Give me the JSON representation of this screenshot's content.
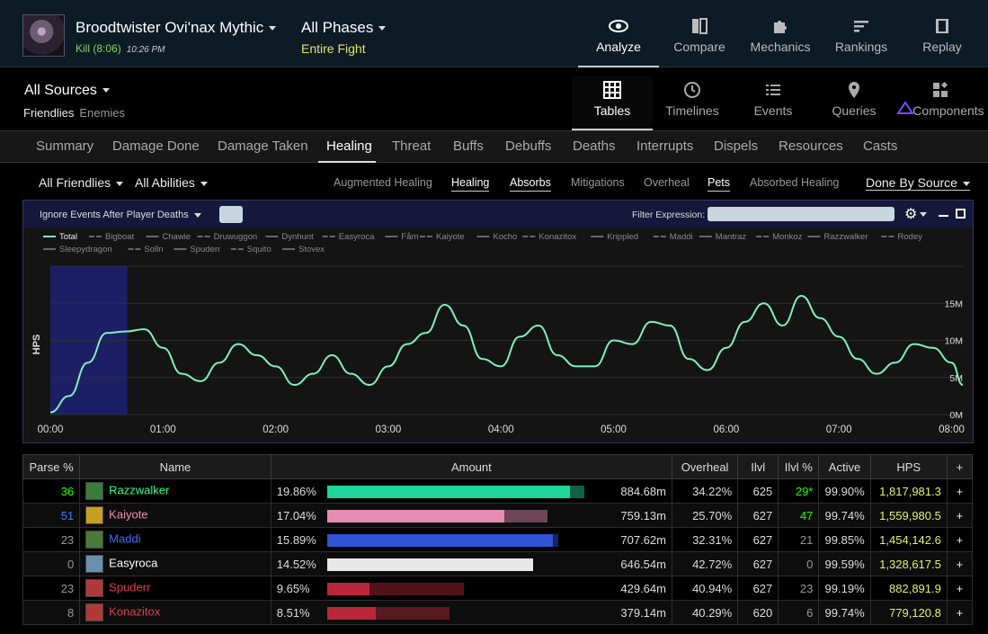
{
  "header": {
    "boss": "Broodtwister Ovi'nax Mythic",
    "kill": "Kill (8:06)",
    "time": "10:26 PM",
    "phase": "All Phases",
    "phase_sub": "Entire Fight",
    "nav": [
      "Analyze",
      "Compare",
      "Mechanics",
      "Rankings",
      "Replay"
    ]
  },
  "subheader": {
    "sources": "All Sources",
    "friendlies": "Friendlies",
    "enemies": "Enemies",
    "views": [
      "Tables",
      "Timelines",
      "Events",
      "Queries",
      "Components"
    ]
  },
  "tabs": [
    "Summary",
    "Damage Done",
    "Damage Taken",
    "Healing",
    "Threat",
    "Buffs",
    "Debuffs",
    "Deaths",
    "Interrupts",
    "Dispels",
    "Resources",
    "Casts"
  ],
  "filters": {
    "friendlies": "All Friendlies",
    "abilities": "All Abilities",
    "subviews": [
      "Augmented Healing",
      "Healing",
      "Absorbs",
      "Mitigations",
      "Overheal",
      "Pets",
      "Absorbed Healing"
    ],
    "done_by": "Done By Source"
  },
  "graph": {
    "ignore": "Ignore Events After Player Deaths",
    "filter_label": "Filter Expression:",
    "legend": [
      "Total",
      "Bigboat",
      "Chawie",
      "Druwuggon",
      "Dynhunt",
      "Easyroca",
      "Fåm",
      "Kaiyote",
      "Kocho",
      "Konazitox",
      "Krippled",
      "Maddi",
      "Mantraz",
      "Monkoz",
      "Razzwalker",
      "Rodey",
      "Sleepydragon",
      "Solln",
      "Spuderr",
      "Squito",
      "Stovex"
    ],
    "ylabel": "HPS",
    "yticks": [
      "0M",
      "5M",
      "10M",
      "15M"
    ],
    "xticks": [
      "00:00",
      "01:00",
      "02:00",
      "03:00",
      "04:00",
      "05:00",
      "06:00",
      "07:00",
      "08:00"
    ]
  },
  "chart_data": {
    "type": "line",
    "ylabel": "HPS",
    "ylim": [
      0,
      20000000
    ],
    "xlim": [
      0,
      486
    ],
    "series": [
      {
        "name": "Total",
        "x": [
          0,
          10,
          20,
          30,
          40,
          50,
          60,
          70,
          80,
          90,
          100,
          110,
          120,
          130,
          140,
          150,
          160,
          170,
          180,
          190,
          200,
          210,
          220,
          230,
          240,
          250,
          260,
          270,
          280,
          290,
          300,
          310,
          320,
          330,
          340,
          350,
          360,
          370,
          380,
          390,
          400,
          410,
          420,
          430,
          440,
          450,
          460,
          470,
          480,
          486
        ],
        "y": [
          300000,
          2500000,
          7000000,
          11000000,
          11200000,
          11500000,
          9000000,
          5500000,
          4500000,
          7000000,
          9500000,
          8000000,
          6500000,
          4000000,
          5500000,
          8000000,
          5500000,
          4000000,
          6500000,
          9500000,
          11000000,
          14800000,
          12000000,
          7500000,
          6500000,
          10500000,
          12000000,
          8000000,
          6500000,
          6500000,
          10000000,
          9500000,
          12500000,
          12000000,
          7500000,
          6000000,
          9000000,
          12500000,
          15000000,
          12000000,
          16000000,
          13000000,
          10500000,
          7500000,
          5500000,
          7000000,
          9500000,
          9000000,
          7000000,
          4000000
        ]
      }
    ]
  },
  "table": {
    "headers": [
      "Parse %",
      "Name",
      "Amount",
      "Overheal",
      "Ilvl",
      "Ilvl %",
      "Active",
      "HPS",
      "+"
    ],
    "rows": [
      {
        "parse": "36",
        "parse_color": "#1eff00",
        "name": "Razzwalker",
        "name_color": "#33ff88",
        "icon_color": "#3a7d3a",
        "pct": "19.86%",
        "fill": 0.85,
        "over": 0.05,
        "bar_color": "#1ed69a",
        "amount": "884.68m",
        "overheal": "34.22%",
        "ilvl": "625",
        "ilvl_pct": "29*",
        "ilvl_pct_color": "#1eff00",
        "active": "99.90%",
        "hps": "1,817,981.3"
      },
      {
        "parse": "51",
        "parse_color": "#3a7dff",
        "name": "Kaiyote",
        "name_color": "#f58cba",
        "icon_color": "#c8a020",
        "pct": "17.04%",
        "fill": 0.62,
        "over": 0.15,
        "bar_color": "#e58cb0",
        "amount": "759.13m",
        "overheal": "25.70%",
        "ilvl": "627",
        "ilvl_pct": "47",
        "ilvl_pct_color": "#1eff00",
        "active": "99.74%",
        "hps": "1,559,980.5"
      },
      {
        "parse": "23",
        "parse_color": "#999999",
        "name": "Maddi",
        "name_color": "#3d6fff",
        "icon_color": "#4a7a3a",
        "pct": "15.89%",
        "fill": 0.79,
        "over": 0.02,
        "bar_color": "#2f52d6",
        "amount": "707.62m",
        "overheal": "32.31%",
        "ilvl": "627",
        "ilvl_pct": "21",
        "ilvl_pct_color": "#999999",
        "active": "99.85%",
        "hps": "1,454,142.6"
      },
      {
        "parse": "0",
        "parse_color": "#999999",
        "name": "Easyroca",
        "name_color": "#ffffff",
        "icon_color": "#6a8fb0",
        "pct": "14.52%",
        "fill": 0.72,
        "over": 0.0,
        "bar_color": "#e8e8e8",
        "amount": "646.54m",
        "overheal": "42.72%",
        "ilvl": "627",
        "ilvl_pct": "0",
        "ilvl_pct_color": "#999999",
        "active": "99.59%",
        "hps": "1,328,617.5"
      },
      {
        "parse": "23",
        "parse_color": "#999999",
        "name": "Spuderr",
        "name_color": "#e04050",
        "icon_color": "#b03a3a",
        "pct": "9.65%",
        "fill": 0.15,
        "over": 0.33,
        "bar_color": "#b8283a",
        "amount": "429.64m",
        "overheal": "40.94%",
        "ilvl": "627",
        "ilvl_pct": "23",
        "ilvl_pct_color": "#999999",
        "active": "99.19%",
        "hps": "882,891.9"
      },
      {
        "parse": "8",
        "parse_color": "#999999",
        "name": "Konazitox",
        "name_color": "#e04050",
        "icon_color": "#b03a3a",
        "pct": "8.51%",
        "fill": 0.17,
        "over": 0.26,
        "bar_color": "#b8283a",
        "amount": "379.14m",
        "overheal": "40.29%",
        "ilvl": "620",
        "ilvl_pct": "6",
        "ilvl_pct_color": "#999999",
        "active": "99.74%",
        "hps": "779,120.8"
      }
    ]
  }
}
